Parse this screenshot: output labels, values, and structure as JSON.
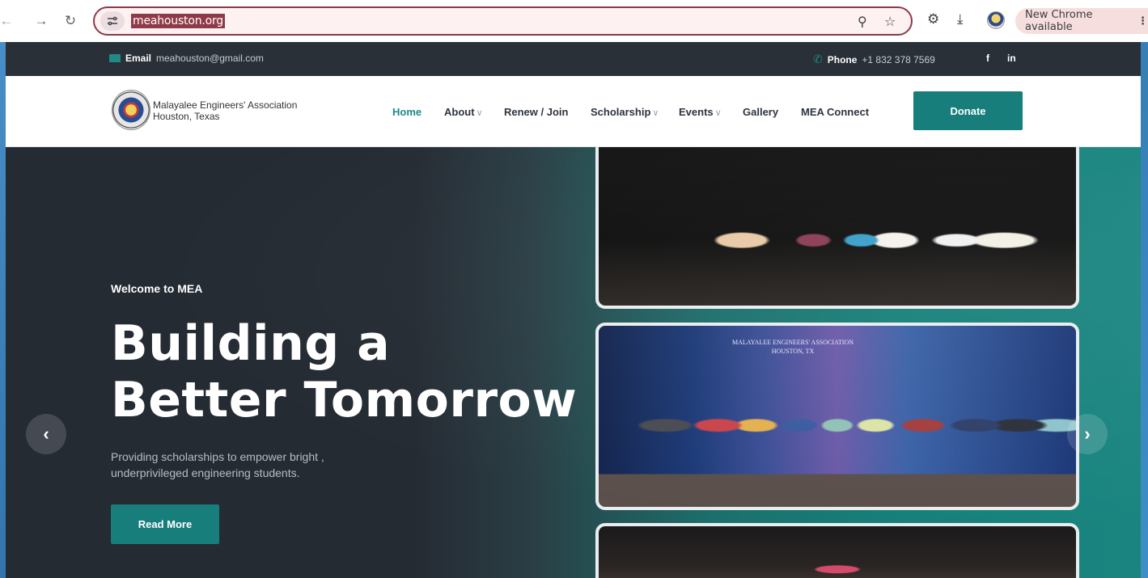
{
  "browser": {
    "url": "meahouston.org",
    "update_label": "New Chrome available",
    "icons": [
      "back-icon",
      "forward-icon",
      "reload-icon",
      "site-settings-icon",
      "zoom-icon",
      "bookmark-star-icon",
      "extensions-icon",
      "download-icon",
      "profile-avatar",
      "menu-dots-icon"
    ]
  },
  "topbar": {
    "email_label": "Email",
    "email_value": "meahouston@gmail.com",
    "phone_label": "Phone",
    "phone_value": "+1 832 378 7569",
    "facebook": "f",
    "linkedin": "in"
  },
  "brand": {
    "name_line1": "Malayalee Engineers' Association",
    "name_line2": "Houston, Texas"
  },
  "nav": {
    "home": "Home",
    "about": "About",
    "renew": "Renew / Join",
    "scholarship": "Scholarship",
    "events": "Events",
    "gallery": "Gallery",
    "connect": "MEA Connect",
    "donate": "Donate"
  },
  "hero": {
    "kicker": "Welcome to MEA",
    "headline_line1": "Building a",
    "headline_line2": "Better Tomorrow",
    "subtitle": "Providing scholarships to empower bright , underprivileged engineering students.",
    "cta": "Read More",
    "banner_line1": "MALAYALEE ENGINEERS' ASSOCIATION",
    "banner_line2": "HOUSTON, TX"
  },
  "colors": {
    "accent": "#177e7b",
    "dark": "#252b33",
    "omnibox_border": "#8b3a4a"
  }
}
